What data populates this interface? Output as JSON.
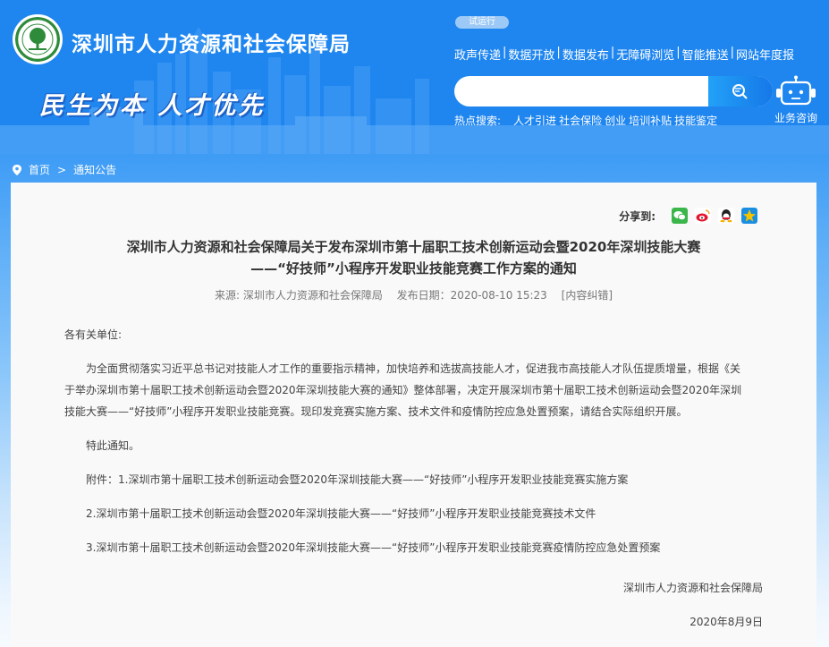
{
  "header": {
    "site_title": "深圳市人力资源和社会保障局",
    "slogan": "民生为本 人才优先",
    "badge": "试运行",
    "topnav": [
      "政声传递",
      "数据开放",
      "数据发布",
      "无障碍浏览",
      "智能推送",
      "网站年度报"
    ],
    "search": {
      "value": "",
      "placeholder": ""
    },
    "hot_label": "热点搜索:",
    "hot_words": [
      "人才引进",
      "社会保险",
      "创业",
      "培训补贴",
      "技能鉴定"
    ],
    "robot_label": "业务咨询"
  },
  "breadcrumb": {
    "home": "首页",
    "sep": ">",
    "current": "通知公告"
  },
  "share": {
    "label": "分享到:",
    "icons": [
      "wechat-icon",
      "weibo-icon",
      "qq-icon",
      "qzone-icon"
    ],
    "colors": {
      "wechat": "#3bb64b",
      "weibo": "#e6162d",
      "qq": "#1a8ee1",
      "qzone": "#f5b400"
    }
  },
  "article": {
    "title_line1": "深圳市人力资源和社会保障局关于发布深圳市第十届职工技术创新运动会暨2020年深圳技能大赛",
    "title_line2": "——“好技师”小程序开发职业技能竞赛工作方案的通知",
    "source": "来源: 深圳市人力资源和社会保障局",
    "date": "发布日期：2020-08-10 15:23",
    "correction": "[内容纠错]",
    "salutation": "各有关单位:",
    "para1": "为全面贯彻落实习近平总书记对技能人才工作的重要指示精神，加快培养和选拔高技能人才，促进我市高技能人才队伍提质增量，根据《关于举办深圳市第十届职工技术创新运动会暨2020年深圳技能大赛的通知》整体部署，决定开展深圳市第十届职工技术创新运动会暨2020年深圳技能大赛——“好技师”小程序开发职业技能竞赛。现印发竞赛实施方案、技术文件和疫情防控应急处置预案，请结合实际组织开展。",
    "notice": "特此通知。",
    "attach1": "附件：1.深圳市第十届职工技术创新运动会暨2020年深圳技能大赛——“好技师”小程序开发职业技能竞赛实施方案",
    "attach2": "2.深圳市第十届职工技术创新运动会暨2020年深圳技能大赛——“好技师”小程序开发职业技能竞赛技术文件",
    "attach3": "3.深圳市第十届职工技术创新运动会暨2020年深圳技能大赛——“好技师”小程序开发职业技能竞赛疫情防控应急处置预案",
    "signature": "深圳市人力资源和社会保障局",
    "sign_date": "2020年8月9日"
  },
  "colors": {
    "brand_blue": "#1f86f0",
    "search_button": "#1678e8"
  }
}
